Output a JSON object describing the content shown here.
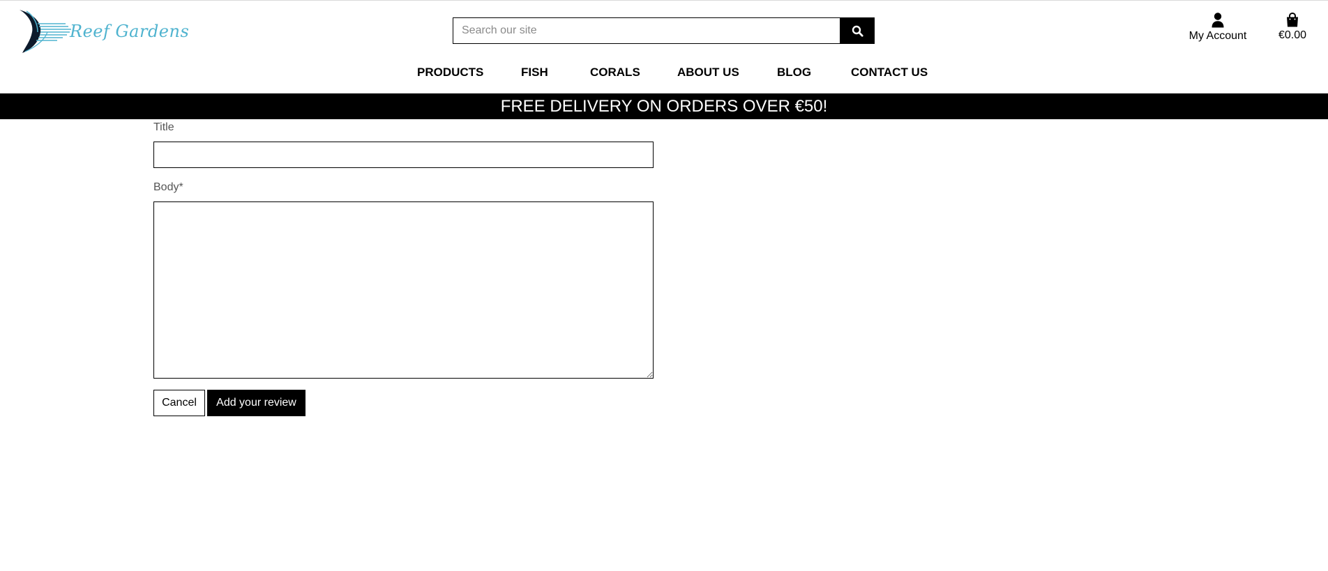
{
  "header": {
    "logo_text": "Reef Gardens",
    "logo_icon": "fish-fin-logo-icon",
    "search": {
      "placeholder": "Search our site",
      "value": "",
      "button_icon": "search-icon"
    },
    "account": {
      "icon": "user-icon",
      "label": "My Account"
    },
    "basket": {
      "icon": "shopping-bag-icon",
      "total": "€0.00"
    }
  },
  "nav": {
    "items": [
      {
        "label": "PRODUCTS"
      },
      {
        "label": "FISH"
      },
      {
        "label": "CORALS"
      },
      {
        "label": "ABOUT US"
      },
      {
        "label": "BLOG"
      },
      {
        "label": "CONTACT US"
      }
    ]
  },
  "banner": {
    "text": "FREE DELIVERY ON ORDERS OVER €50!"
  },
  "review_form": {
    "title_label": "Title",
    "title_value": "",
    "body_label": "Body*",
    "body_value": "",
    "cancel_label": "Cancel",
    "submit_label": "Add your review"
  },
  "colors": {
    "brand_accent": "#4fb3cf",
    "banner_bg": "#000000",
    "banner_text": "#ffffff"
  }
}
